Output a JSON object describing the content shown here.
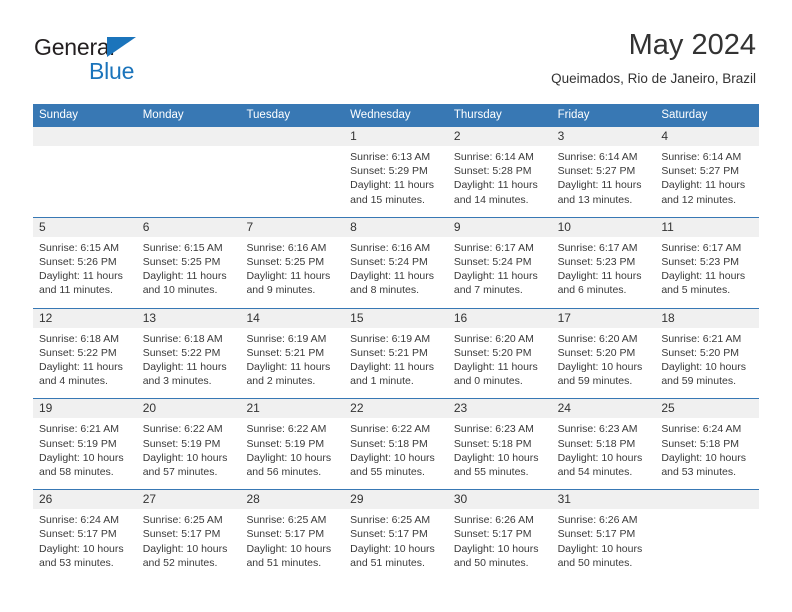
{
  "brand": {
    "name_part1": "General",
    "name_part2": "Blue",
    "triangle_icon": "triangle-icon",
    "accent_color": "#1b74bb"
  },
  "header": {
    "title": "May 2024",
    "subtitle": "Queimados, Rio de Janeiro, Brazil"
  },
  "calendar": {
    "header_bg": "#3878b4",
    "daynum_bg": "#f0f0f0",
    "weekdays": [
      "Sunday",
      "Monday",
      "Tuesday",
      "Wednesday",
      "Thursday",
      "Friday",
      "Saturday"
    ],
    "weeks": [
      [
        {
          "day": "",
          "sunrise": "",
          "sunset": "",
          "daylight": ""
        },
        {
          "day": "",
          "sunrise": "",
          "sunset": "",
          "daylight": ""
        },
        {
          "day": "",
          "sunrise": "",
          "sunset": "",
          "daylight": ""
        },
        {
          "day": "1",
          "sunrise": "Sunrise: 6:13 AM",
          "sunset": "Sunset: 5:29 PM",
          "daylight": "Daylight: 11 hours and 15 minutes."
        },
        {
          "day": "2",
          "sunrise": "Sunrise: 6:14 AM",
          "sunset": "Sunset: 5:28 PM",
          "daylight": "Daylight: 11 hours and 14 minutes."
        },
        {
          "day": "3",
          "sunrise": "Sunrise: 6:14 AM",
          "sunset": "Sunset: 5:27 PM",
          "daylight": "Daylight: 11 hours and 13 minutes."
        },
        {
          "day": "4",
          "sunrise": "Sunrise: 6:14 AM",
          "sunset": "Sunset: 5:27 PM",
          "daylight": "Daylight: 11 hours and 12 minutes."
        }
      ],
      [
        {
          "day": "5",
          "sunrise": "Sunrise: 6:15 AM",
          "sunset": "Sunset: 5:26 PM",
          "daylight": "Daylight: 11 hours and 11 minutes."
        },
        {
          "day": "6",
          "sunrise": "Sunrise: 6:15 AM",
          "sunset": "Sunset: 5:25 PM",
          "daylight": "Daylight: 11 hours and 10 minutes."
        },
        {
          "day": "7",
          "sunrise": "Sunrise: 6:16 AM",
          "sunset": "Sunset: 5:25 PM",
          "daylight": "Daylight: 11 hours and 9 minutes."
        },
        {
          "day": "8",
          "sunrise": "Sunrise: 6:16 AM",
          "sunset": "Sunset: 5:24 PM",
          "daylight": "Daylight: 11 hours and 8 minutes."
        },
        {
          "day": "9",
          "sunrise": "Sunrise: 6:17 AM",
          "sunset": "Sunset: 5:24 PM",
          "daylight": "Daylight: 11 hours and 7 minutes."
        },
        {
          "day": "10",
          "sunrise": "Sunrise: 6:17 AM",
          "sunset": "Sunset: 5:23 PM",
          "daylight": "Daylight: 11 hours and 6 minutes."
        },
        {
          "day": "11",
          "sunrise": "Sunrise: 6:17 AM",
          "sunset": "Sunset: 5:23 PM",
          "daylight": "Daylight: 11 hours and 5 minutes."
        }
      ],
      [
        {
          "day": "12",
          "sunrise": "Sunrise: 6:18 AM",
          "sunset": "Sunset: 5:22 PM",
          "daylight": "Daylight: 11 hours and 4 minutes."
        },
        {
          "day": "13",
          "sunrise": "Sunrise: 6:18 AM",
          "sunset": "Sunset: 5:22 PM",
          "daylight": "Daylight: 11 hours and 3 minutes."
        },
        {
          "day": "14",
          "sunrise": "Sunrise: 6:19 AM",
          "sunset": "Sunset: 5:21 PM",
          "daylight": "Daylight: 11 hours and 2 minutes."
        },
        {
          "day": "15",
          "sunrise": "Sunrise: 6:19 AM",
          "sunset": "Sunset: 5:21 PM",
          "daylight": "Daylight: 11 hours and 1 minute."
        },
        {
          "day": "16",
          "sunrise": "Sunrise: 6:20 AM",
          "sunset": "Sunset: 5:20 PM",
          "daylight": "Daylight: 11 hours and 0 minutes."
        },
        {
          "day": "17",
          "sunrise": "Sunrise: 6:20 AM",
          "sunset": "Sunset: 5:20 PM",
          "daylight": "Daylight: 10 hours and 59 minutes."
        },
        {
          "day": "18",
          "sunrise": "Sunrise: 6:21 AM",
          "sunset": "Sunset: 5:20 PM",
          "daylight": "Daylight: 10 hours and 59 minutes."
        }
      ],
      [
        {
          "day": "19",
          "sunrise": "Sunrise: 6:21 AM",
          "sunset": "Sunset: 5:19 PM",
          "daylight": "Daylight: 10 hours and 58 minutes."
        },
        {
          "day": "20",
          "sunrise": "Sunrise: 6:22 AM",
          "sunset": "Sunset: 5:19 PM",
          "daylight": "Daylight: 10 hours and 57 minutes."
        },
        {
          "day": "21",
          "sunrise": "Sunrise: 6:22 AM",
          "sunset": "Sunset: 5:19 PM",
          "daylight": "Daylight: 10 hours and 56 minutes."
        },
        {
          "day": "22",
          "sunrise": "Sunrise: 6:22 AM",
          "sunset": "Sunset: 5:18 PM",
          "daylight": "Daylight: 10 hours and 55 minutes."
        },
        {
          "day": "23",
          "sunrise": "Sunrise: 6:23 AM",
          "sunset": "Sunset: 5:18 PM",
          "daylight": "Daylight: 10 hours and 55 minutes."
        },
        {
          "day": "24",
          "sunrise": "Sunrise: 6:23 AM",
          "sunset": "Sunset: 5:18 PM",
          "daylight": "Daylight: 10 hours and 54 minutes."
        },
        {
          "day": "25",
          "sunrise": "Sunrise: 6:24 AM",
          "sunset": "Sunset: 5:18 PM",
          "daylight": "Daylight: 10 hours and 53 minutes."
        }
      ],
      [
        {
          "day": "26",
          "sunrise": "Sunrise: 6:24 AM",
          "sunset": "Sunset: 5:17 PM",
          "daylight": "Daylight: 10 hours and 53 minutes."
        },
        {
          "day": "27",
          "sunrise": "Sunrise: 6:25 AM",
          "sunset": "Sunset: 5:17 PM",
          "daylight": "Daylight: 10 hours and 52 minutes."
        },
        {
          "day": "28",
          "sunrise": "Sunrise: 6:25 AM",
          "sunset": "Sunset: 5:17 PM",
          "daylight": "Daylight: 10 hours and 51 minutes."
        },
        {
          "day": "29",
          "sunrise": "Sunrise: 6:25 AM",
          "sunset": "Sunset: 5:17 PM",
          "daylight": "Daylight: 10 hours and 51 minutes."
        },
        {
          "day": "30",
          "sunrise": "Sunrise: 6:26 AM",
          "sunset": "Sunset: 5:17 PM",
          "daylight": "Daylight: 10 hours and 50 minutes."
        },
        {
          "day": "31",
          "sunrise": "Sunrise: 6:26 AM",
          "sunset": "Sunset: 5:17 PM",
          "daylight": "Daylight: 10 hours and 50 minutes."
        },
        {
          "day": "",
          "sunrise": "",
          "sunset": "",
          "daylight": ""
        }
      ]
    ]
  }
}
